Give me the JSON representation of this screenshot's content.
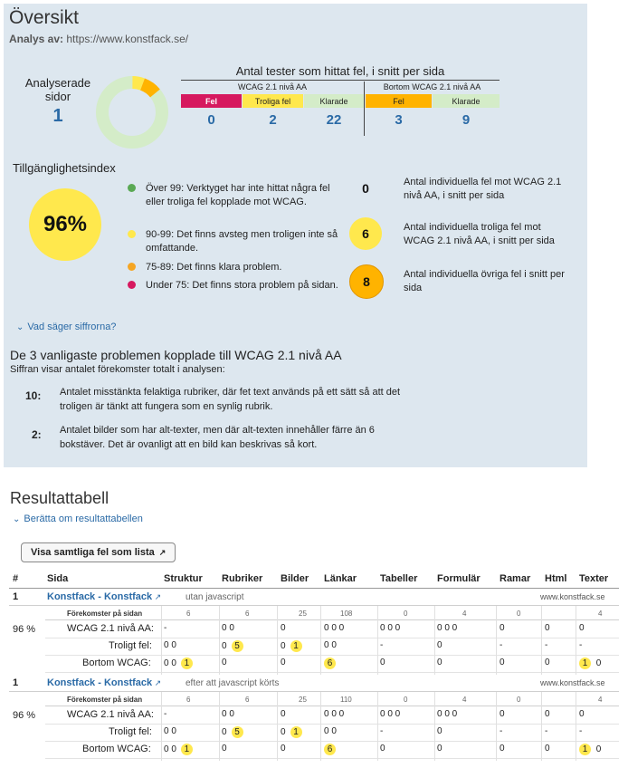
{
  "overview": {
    "title": "Översikt",
    "analysis_label": "Analys av:",
    "analysis_url": "https://www.konstfack.se/",
    "analyzed_pages_label": "Analyserade sidor",
    "analyzed_pages_value": "1",
    "donut_chart": {
      "segments": [
        {
          "label": "Fel",
          "value": 0,
          "color": "#d6195f"
        },
        {
          "label": "Troliga fel",
          "value": 2,
          "color": "#ffe84d"
        },
        {
          "label": "Bortom WCAG fel",
          "value": 3,
          "color": "#ffb300"
        },
        {
          "label": "Klarade",
          "value": 31,
          "color": "#d4ecc8"
        }
      ]
    },
    "tests_title": "Antal tester som hittat fel, i snitt per sida",
    "group_wcag": "WCAG 2.1 nivå AA",
    "group_beyond": "Bortom WCAG 2.1 nivå AA",
    "cols": [
      {
        "label": "Fel",
        "value": "0",
        "color": "#d6195f",
        "text_color": "#ffffff"
      },
      {
        "label": "Troliga fel",
        "value": "2",
        "color": "#ffe84d",
        "text_color": "#222222"
      },
      {
        "label": "Klarade",
        "value": "22",
        "color": "#d4ecc8",
        "text_color": "#222222"
      },
      {
        "label": "Fel",
        "value": "3",
        "color": "#ffb300",
        "text_color": "#222222"
      },
      {
        "label": "Klarade",
        "value": "9",
        "color": "#d4ecc8",
        "text_color": "#222222"
      }
    ],
    "index_title": "Tillgänglighetsindex",
    "index_value": "96%",
    "legend": [
      {
        "color": "#5aa954",
        "text": "Över 99: Verktyget har inte hittat några fel eller troliga fel kopplade mot WCAG."
      },
      {
        "color": "#ffe84d",
        "text": "90-99: Det finns avsteg men troligen inte så omfattande."
      },
      {
        "color": "#f5a623",
        "text": "75-89: Det finns klara problem."
      },
      {
        "color": "#d6195f",
        "text": "Under 75: Det finns stora problem på sidan."
      }
    ],
    "counts": [
      {
        "value": "0",
        "color": "none",
        "text": "Antal individuella fel mot WCAG 2.1 nivå AA, i snitt per sida"
      },
      {
        "value": "6",
        "color": "#ffe84d",
        "text": "Antal individuella troliga fel mot WCAG 2.1 nivå AA, i snitt per sida"
      },
      {
        "value": "8",
        "color": "#ffb300",
        "text": "Antal individuella övriga fel i snitt per sida"
      }
    ],
    "expander": "Vad säger siffrorna?",
    "top_title": "De 3 vanligaste problemen kopplade till WCAG 2.1 nivå AA",
    "top_sub": "Siffran visar antalet förekomster totalt i analysen:",
    "top_items": [
      {
        "count": "10:",
        "text": "Antalet misstänkta felaktiga rubriker, där fet text används på ett sätt så att det troligen är tänkt att fungera som en synlig rubrik."
      },
      {
        "count": "2:",
        "text": "Antalet bilder som har alt-texter, men där alt-texten innehåller färre än 6 bokstäver. Det är ovanligt att en bild kan beskrivas så kort."
      }
    ]
  },
  "results": {
    "title": "Resultattabell",
    "expander": "Berätta om resultattabellen",
    "button": "Visa samtliga fel som lista",
    "headers": [
      "#",
      "Sida",
      "Struktur",
      "Rubriker",
      "Bilder",
      "Länkar",
      "Tabeller",
      "Formulär",
      "Ramar",
      "Html",
      "Texter"
    ],
    "occurrences_label": "Förekomster på sidan",
    "rows": [
      {
        "num": "1",
        "page": "Konstfack - Konstfack",
        "mode": "utan javascript",
        "domain": "www.konstfack.se",
        "index": "96 %",
        "occ": [
          "6",
          "6",
          "25",
          "108",
          "0",
          "4",
          "0",
          "",
          "4"
        ],
        "wcag_label": "WCAG 2.1 nivå AA:",
        "wcag": [
          "-",
          "0  0",
          "0",
          "0  0  0",
          "0  0  0",
          "0  0  0",
          "0",
          "0",
          "0"
        ],
        "likely_label": "Troligt fel:",
        "likely": [
          "0  0",
          "0",
          "0",
          "0  0",
          "-",
          "0",
          "-",
          "-",
          "-"
        ],
        "likely_hl": [
          "",
          "5",
          "1",
          "",
          "",
          "",
          "",
          "",
          ""
        ],
        "beyond_label": "Bortom WCAG:",
        "beyond": [
          "0  0",
          "0",
          "0",
          "",
          "0",
          "0",
          "0",
          "0",
          ""
        ],
        "beyond_hl": [
          "1",
          "",
          "",
          "6",
          "",
          "",
          "",
          "",
          "1"
        ],
        "beyond_tail": [
          "",
          "",
          "",
          "",
          "",
          "",
          "",
          "",
          "0"
        ]
      },
      {
        "num": "1",
        "page": "Konstfack - Konstfack",
        "mode": "efter att javascript körts",
        "domain": "www.konstfack.se",
        "index": "96 %",
        "occ": [
          "6",
          "6",
          "25",
          "110",
          "0",
          "4",
          "0",
          "",
          "4"
        ],
        "wcag_label": "WCAG 2.1 nivå AA:",
        "wcag": [
          "-",
          "0  0",
          "0",
          "0  0  0",
          "0  0  0",
          "0  0  0",
          "0",
          "0",
          "0"
        ],
        "likely_label": "Troligt fel:",
        "likely": [
          "0  0",
          "0",
          "0",
          "0  0",
          "-",
          "0",
          "-",
          "-",
          "-"
        ],
        "likely_hl": [
          "",
          "5",
          "1",
          "",
          "",
          "",
          "",
          "",
          ""
        ],
        "beyond_label": "Bortom WCAG:",
        "beyond": [
          "0  0",
          "0",
          "0",
          "",
          "0",
          "0",
          "0",
          "0",
          ""
        ],
        "beyond_hl": [
          "1",
          "",
          "",
          "6",
          "",
          "",
          "",
          "",
          "1"
        ],
        "beyond_tail": [
          "",
          "",
          "",
          "",
          "",
          "",
          "",
          "",
          "0"
        ]
      }
    ]
  }
}
